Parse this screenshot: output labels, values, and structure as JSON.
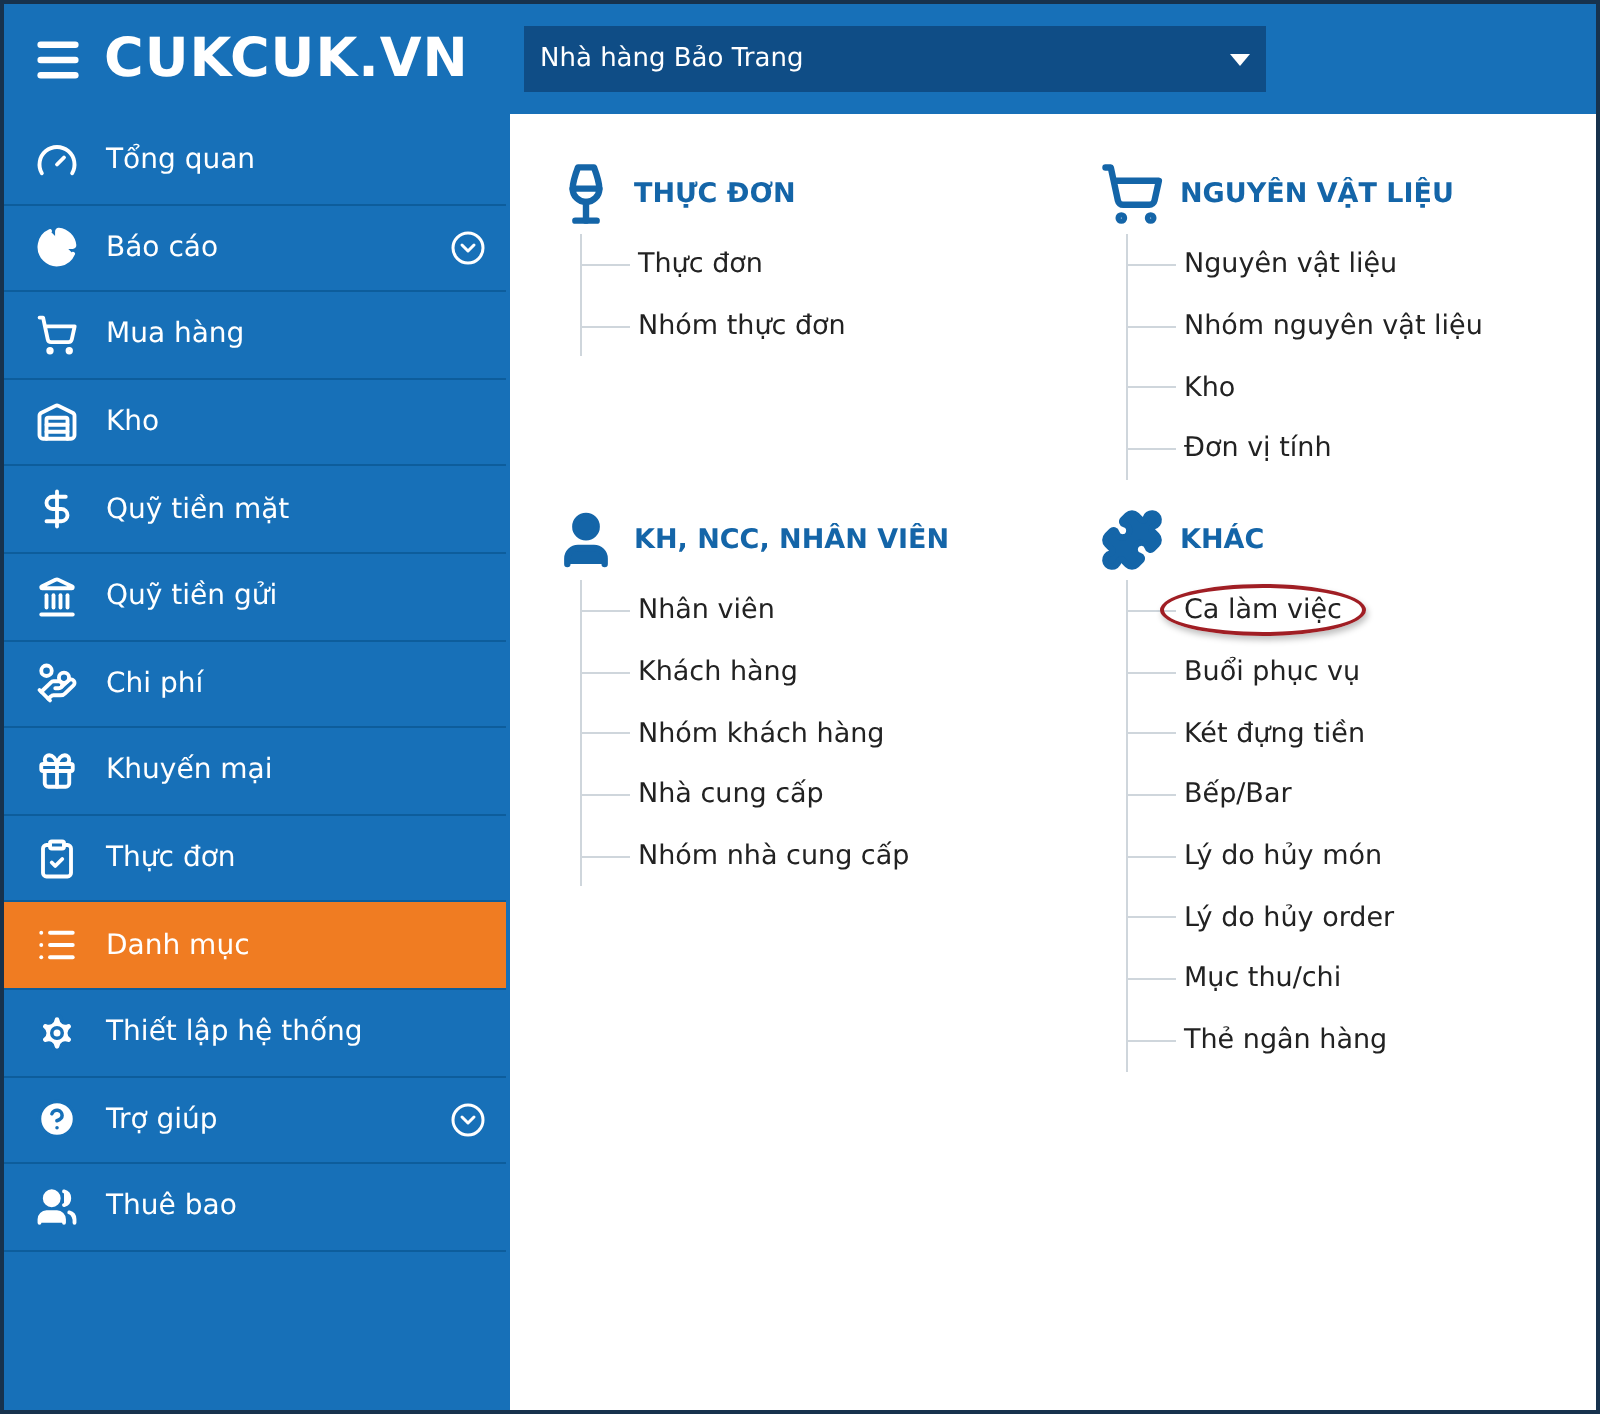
{
  "header": {
    "logo": "CUKCUK.VN",
    "restaurant_select": {
      "value": "Nhà hàng Bảo Trang"
    }
  },
  "sidebar": {
    "items": [
      {
        "label": "Tổng quan",
        "selected": false,
        "expandable": false
      },
      {
        "label": "Báo cáo",
        "selected": false,
        "expandable": true
      },
      {
        "label": "Mua hàng",
        "selected": false,
        "expandable": false
      },
      {
        "label": "Kho",
        "selected": false,
        "expandable": false
      },
      {
        "label": "Quỹ tiền mặt",
        "selected": false,
        "expandable": false
      },
      {
        "label": "Quỹ tiền gửi",
        "selected": false,
        "expandable": false
      },
      {
        "label": "Chi phí",
        "selected": false,
        "expandable": false
      },
      {
        "label": "Khuyến mại",
        "selected": false,
        "expandable": false
      },
      {
        "label": "Thực đơn",
        "selected": false,
        "expandable": false
      },
      {
        "label": "Danh mục",
        "selected": true,
        "expandable": false
      },
      {
        "label": "Thiết lập hệ thống",
        "selected": false,
        "expandable": false
      },
      {
        "label": "Trợ giúp",
        "selected": false,
        "expandable": true
      },
      {
        "label": "Thuê bao",
        "selected": false,
        "expandable": false
      }
    ]
  },
  "sections": [
    {
      "title": "THỰC ĐƠN",
      "items": [
        {
          "label": "Thực đơn",
          "circled": false
        },
        {
          "label": "Nhóm thực đơn",
          "circled": false
        }
      ]
    },
    {
      "title": "NGUYÊN VẬT LIỆU",
      "items": [
        {
          "label": "Nguyên vật liệu",
          "circled": false
        },
        {
          "label": "Nhóm nguyên vật liệu",
          "circled": false
        },
        {
          "label": "Kho",
          "circled": false
        },
        {
          "label": "Đơn vị tính",
          "circled": false
        }
      ]
    },
    {
      "title": "KH, NCC, NHÂN VIÊN",
      "items": [
        {
          "label": "Nhân viên",
          "circled": false
        },
        {
          "label": "Khách hàng",
          "circled": false
        },
        {
          "label": "Nhóm khách hàng",
          "circled": false
        },
        {
          "label": "Nhà cung cấp",
          "circled": false
        },
        {
          "label": "Nhóm nhà cung cấp",
          "circled": false
        }
      ]
    },
    {
      "title": "KHÁC",
      "items": [
        {
          "label": "Ca làm việc",
          "circled": true
        },
        {
          "label": "Buổi phục vụ",
          "circled": false
        },
        {
          "label": "Két đựng tiền",
          "circled": false
        },
        {
          "label": "Bếp/Bar",
          "circled": false
        },
        {
          "label": "Lý do hủy món",
          "circled": false
        },
        {
          "label": "Lý do hủy order",
          "circled": false
        },
        {
          "label": "Mục thu/chi",
          "circled": false
        },
        {
          "label": "Thẻ ngân hàng",
          "circled": false
        }
      ]
    }
  ]
}
